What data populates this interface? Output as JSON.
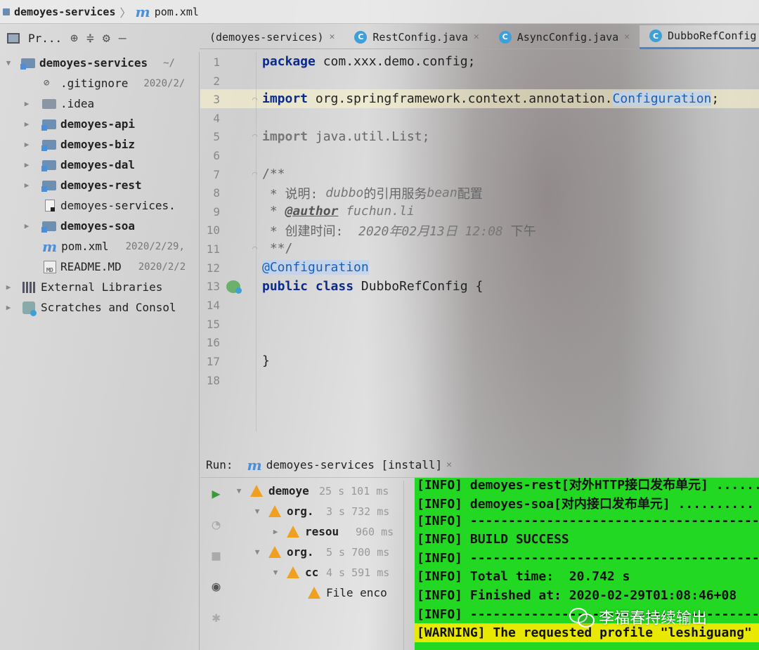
{
  "breadcrumb": {
    "project": "demoyes-services",
    "file": "pom.xml"
  },
  "project_toolbar": {
    "view_label": "Pr..."
  },
  "tabs": [
    {
      "label": "(demoyes-services)",
      "icon": "none",
      "active": false
    },
    {
      "label": "RestConfig.java",
      "icon": "class-icon",
      "active": false
    },
    {
      "label": "AsyncConfig.java",
      "icon": "class-icon",
      "active": false
    },
    {
      "label": "DubboRefConfig",
      "icon": "class-icon",
      "active": true
    }
  ],
  "tree": {
    "root": {
      "name": "demoyes-services",
      "suffix": "~/"
    },
    "items": [
      {
        "name": ".gitignore",
        "date": "2020/2/",
        "type": "gitignore",
        "bold": false
      },
      {
        "name": ".idea",
        "type": "folder",
        "bold": false
      },
      {
        "name": "demoyes-api",
        "type": "module",
        "bold": true
      },
      {
        "name": "demoyes-biz",
        "type": "module",
        "bold": true
      },
      {
        "name": "demoyes-dal",
        "type": "module",
        "bold": true
      },
      {
        "name": "demoyes-rest",
        "type": "module",
        "bold": true
      },
      {
        "name": "demoyes-services.",
        "type": "file",
        "bold": false
      },
      {
        "name": "demoyes-soa",
        "type": "module",
        "bold": true
      },
      {
        "name": "pom.xml",
        "date": "2020/2/29,",
        "type": "maven",
        "bold": false
      },
      {
        "name": "README.MD",
        "date": "2020/2/2",
        "type": "markdown",
        "bold": false
      }
    ],
    "external_libraries": "External Libraries",
    "scratches": "Scratches and Consol"
  },
  "editor": {
    "line_numbers": [
      "1",
      "2",
      "3",
      "4",
      "5",
      "6",
      "7",
      "8",
      "9",
      "10",
      "11",
      "12",
      "13",
      "14",
      "15",
      "16",
      "17",
      "18"
    ],
    "code": {
      "l1_kw": "package",
      "l1_rest": " com.xxx.demo.config;",
      "l3_kw": "import",
      "l3_pkg": " org.springframework.context.annotation.",
      "l3_cls": "Configuration",
      "l3_semi": ";",
      "l5_kw": "import",
      "l5_rest": " java.util.List;",
      "l7": "/**",
      "l8_a": " * 说明: ",
      "l8_b": "dubbo",
      "l8_c": "的引用服务",
      "l8_d": "bean",
      "l8_e": "配置",
      "l9_a": " * ",
      "l9_tag": "@author",
      "l9_b": " fuchun.li",
      "l10_a": " * 创建时间: ",
      "l10_b": " 2020年02月13日 12:08 ",
      "l10_c": "下午",
      "l11": " **/",
      "l12": "@Configuration",
      "l13_kw": "public class",
      "l13_rest": " DubboRefConfig {",
      "l17": "}"
    }
  },
  "run": {
    "label": "Run:",
    "tab": "demoyes-services [install]",
    "tree": [
      {
        "name": "demoye",
        "time": "25 s 101 ms",
        "bold": true
      },
      {
        "name": "org.",
        "time": "3 s 732 ms",
        "bold": false
      },
      {
        "name": "resou",
        "time": "960 ms",
        "bold": false
      },
      {
        "name": "org.",
        "time": "5 s 700 ms",
        "bold": false
      },
      {
        "name": "cc",
        "time": "4 s 591 ms",
        "bold": false
      },
      {
        "name": "File enco",
        "time": "",
        "bold": false
      }
    ]
  },
  "console": {
    "lines": [
      "[INFO] demoyes-rest[对外HTTP接口发布单元] ......",
      "[INFO] demoyes-soa[对内接口发布单元] ..........",
      "[INFO] ------------------------------------------------",
      "[INFO] BUILD SUCCESS",
      "[INFO] ------------------------------------------------",
      "[INFO] Total time:  20.742 s",
      "[INFO] Finished at: 2020-02-29T01:08:46+08",
      "[INFO] -------------------------------------------------",
      "[WARNING] The requested profile \"leshiguang\""
    ]
  },
  "watermark": "李福春持续输出",
  "colors": {
    "console_bg": "#22d822",
    "warning_bg": "#e8e800",
    "accent": "#4a86c8"
  }
}
